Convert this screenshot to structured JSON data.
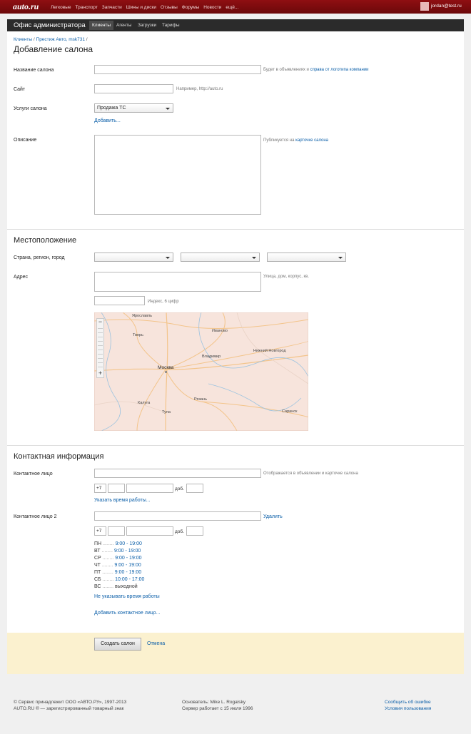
{
  "topbar": {
    "logo": "auto.ru",
    "nav": [
      "Легковые",
      "Транспорт",
      "Запчасти",
      "Шины и диски",
      "Отзывы",
      "Форумы",
      "Новости",
      "ещё..."
    ],
    "user_email": "jordan@test.ru"
  },
  "admin": {
    "title": "Офис администратора",
    "tabs": [
      "Клиенты",
      "Агенты",
      "Загрузки",
      "Тарифы"
    ],
    "active_tab": "Клиенты"
  },
  "breadcrumb": {
    "items": [
      "Клиенты",
      "Престиж Авто, msk731"
    ],
    "separator": "/"
  },
  "page_title": "Добавление салона",
  "form": {
    "salon_name_label": "Название салона",
    "salon_name_hint_prefix": "Будет в объявлениях и",
    "salon_name_hint_link": "справа от логотипа компании",
    "site_label": "Сайт",
    "site_hint": "Например, http://auto.ru",
    "services_label": "Услуги салона",
    "services_selected": "Продажа ТС",
    "add_service": "Добавить...",
    "description_label": "Описание",
    "description_hint_prefix": "Публикуется на",
    "description_hint_link": "карточке салона"
  },
  "location": {
    "title": "Местоположение",
    "region_label": "Страна, регион, город",
    "address_label": "Адрес",
    "address_hint": "Улица, дом, корпус, кв.",
    "index_hint": "Индекс, 6 цифр",
    "map_cities": [
      "Ярославль",
      "Тверь",
      "Иваново",
      "Владимир",
      "Нижний Новгород",
      "Москва",
      "Калуга",
      "Тула",
      "Рязань",
      "Саранск"
    ],
    "zoom_minus": "−",
    "zoom_plus": "+"
  },
  "contacts": {
    "title": "Контактная информация",
    "contact1_label": "Контактное лицо",
    "contact1_hint": "Отображается в объявлении и карточке салона",
    "phone_prefix": "+7",
    "ext_label": "доб.",
    "work_time_link": "Указать время работы...",
    "contact2_label": "Контактное лицо 2",
    "delete_link": "Удалить",
    "schedule": [
      {
        "day": "ПН",
        "dots": "........",
        "time": "9:00 - 19:00"
      },
      {
        "day": "ВТ",
        "dots": "........",
        "time": "9:00 - 19:00"
      },
      {
        "day": "СР",
        "dots": "........",
        "time": "9:00 - 19:00"
      },
      {
        "day": "ЧТ",
        "dots": "........",
        "time": "9:00 - 19:00"
      },
      {
        "day": "ПТ",
        "dots": "........",
        "time": "9:00 - 19:00"
      },
      {
        "day": "СБ",
        "dots": "........",
        "time": "10:00 - 17:00"
      },
      {
        "day": "ВС",
        "dots": "........",
        "time": "выходной"
      }
    ],
    "no_work_time_link": "Не указывать время работы",
    "add_contact_link": "Добавить контактное лицо..."
  },
  "actions": {
    "create": "Создать салон",
    "cancel": "Отмена"
  },
  "footer": {
    "copyright": "© Сервис принадлежит ООО «АВТО.РУ», 1997-2013",
    "trademark": "AUTO.RU ® — зарегистрированный товарный знак",
    "founder": "Основатель: Mike L. Rogalsky",
    "server": "Сервер работает с 15 июля 1996",
    "report_error": "Сообщить об ошибке",
    "terms": "Условия пользования"
  },
  "colors": {
    "brand": "#8f0f12",
    "link": "#0a5ea8",
    "admin_bar": "#2b2b2b",
    "action_band": "#fbf1cf"
  }
}
